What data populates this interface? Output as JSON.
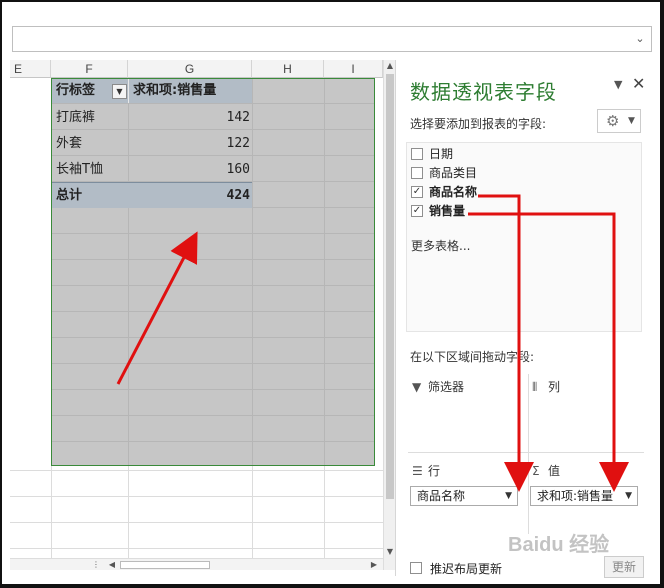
{
  "formula_bar": {
    "dropdown_glyph": "⌄"
  },
  "sheet": {
    "columns": [
      "E",
      "F",
      "G",
      "H",
      "I"
    ],
    "pivot": {
      "header_row_label": "行标签",
      "header_value_label": "求和项:销售量",
      "rows": [
        {
          "label": "打底裤",
          "value": "142"
        },
        {
          "label": "外套",
          "value": "122"
        },
        {
          "label": "长袖T恤",
          "value": "160"
        }
      ],
      "total_label": "总计",
      "total_value": "424"
    }
  },
  "pane": {
    "title": "数据透视表字段",
    "subtitle": "选择要添加到报表的字段:",
    "fields": [
      {
        "label": "日期",
        "checked": false
      },
      {
        "label": "商品类目",
        "checked": false
      },
      {
        "label": "商品名称",
        "checked": true
      },
      {
        "label": "销售量",
        "checked": true
      }
    ],
    "more_tables": "更多表格...",
    "drag_caption": "在以下区域间拖动字段:",
    "areas": {
      "filters": {
        "title": "筛选器",
        "icon": "filter-icon"
      },
      "columns": {
        "title": "列",
        "icon": "columns-icon"
      },
      "rows": {
        "title": "行",
        "icon": "rows-icon",
        "item": "商品名称"
      },
      "values": {
        "title": "值",
        "icon": "sigma-icon",
        "item": "求和项:销售量"
      }
    },
    "defer_label": "推迟布局更新",
    "update_label": "更新"
  },
  "annotation_color": "#e01010",
  "watermark": "Baidu 经验"
}
